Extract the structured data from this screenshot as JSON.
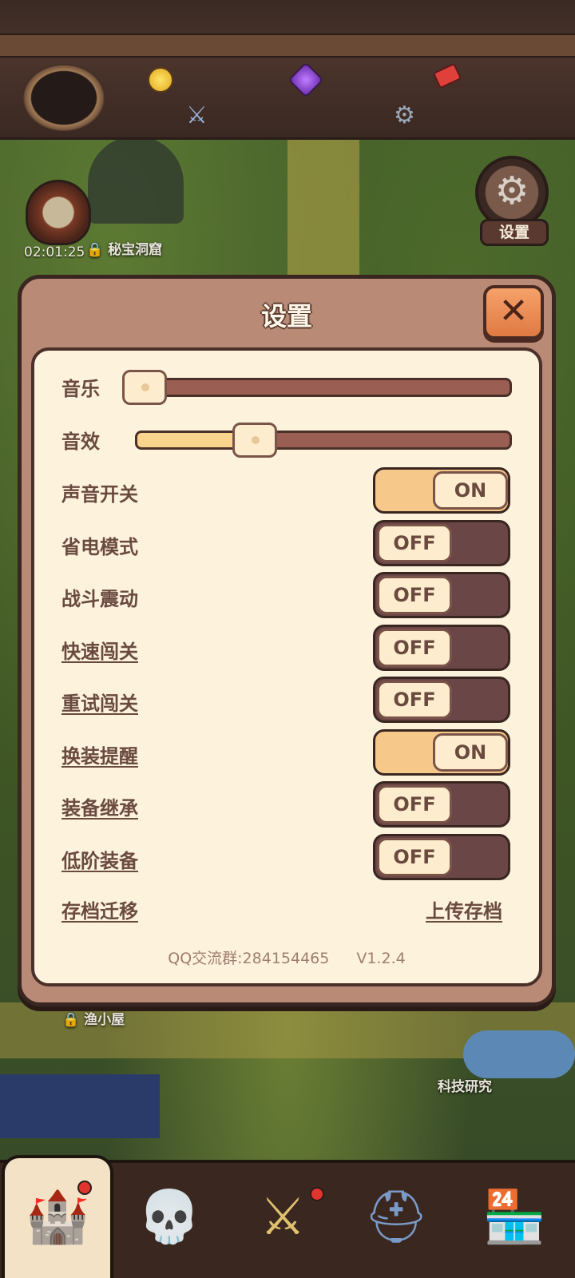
{
  "hud": {
    "chest_timer": "02:01:25",
    "settings_button_label": "设置"
  },
  "map": {
    "cave_label": "秘宝洞窟",
    "fishing_hut_label": "渔小屋",
    "tech_label": "科技研究"
  },
  "settings": {
    "title": "设置",
    "music_label": "音乐",
    "music_level": 0.02,
    "sfx_label": "音效",
    "sfx_level": 0.28,
    "toggles": [
      {
        "label": "声音开关",
        "state": "ON",
        "on": true,
        "link": false
      },
      {
        "label": "省电模式",
        "state": "OFF",
        "on": false,
        "link": false
      },
      {
        "label": "战斗震动",
        "state": "OFF",
        "on": false,
        "link": false
      },
      {
        "label": "快速闯关",
        "state": "OFF",
        "on": false,
        "link": true
      },
      {
        "label": "重试闯关",
        "state": "OFF",
        "on": false,
        "link": true
      },
      {
        "label": "换装提醒",
        "state": "ON",
        "on": true,
        "link": true
      },
      {
        "label": "装备继承",
        "state": "OFF",
        "on": false,
        "link": true
      },
      {
        "label": "低阶装备",
        "state": "OFF",
        "on": false,
        "link": true
      }
    ],
    "archive_label": "存档迁移",
    "upload_label": "上传存档",
    "qq_group": "QQ交流群:284154465",
    "version": "V1.2.4"
  },
  "colors": {
    "panel": "#fdf3dd",
    "modal": "#b98a76",
    "toggle_on": "#f6c98a",
    "toggle_off": "#6b4646",
    "close": "#e07a43"
  },
  "nav": {
    "tabs": [
      {
        "name": "castle-icon",
        "badge": true,
        "active": true
      },
      {
        "name": "skull-icon",
        "badge": false,
        "active": false
      },
      {
        "name": "crossed-swords-icon",
        "badge": true,
        "active": false
      },
      {
        "name": "knight-helmet-icon",
        "badge": false,
        "active": false
      },
      {
        "name": "shop-icon",
        "badge": false,
        "active": false
      }
    ]
  }
}
